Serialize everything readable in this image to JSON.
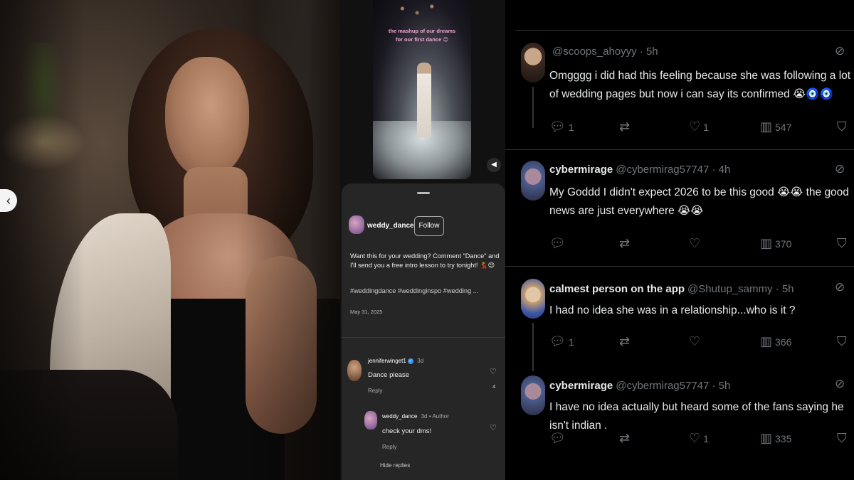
{
  "instagram": {
    "video_caption_line1": "the mashup of our dreams",
    "video_caption_line2": "for our first dance 😊",
    "username": "weddy_dance",
    "follow_label": "Follow",
    "caption": "Want this for your wedding? Comment \"Dance\" and I'll send you a free intro lesson to try tonight! 💃😍",
    "tags": "#weddingdance #weddinginspo #wedding ...",
    "date": "May 31, 2025",
    "comments": [
      {
        "user": "jenniferwinget1",
        "time": "3d",
        "text": "Dance please",
        "reply_label": "Reply",
        "likes": "4"
      },
      {
        "user": "weddy_dance",
        "meta": "3d • Author",
        "text": "check your dms!",
        "reply_label": "Reply"
      }
    ],
    "hide_replies_label": "Hide replies"
  },
  "x": {
    "tweets": [
      {
        "display_name": "",
        "handle": "@scoops_ahoyyy · 5h",
        "text": "Omgggg i did had this feeling because she was following a lot of wedding pages but now i can say its confirmed 😭🧿🧿",
        "replies": "1",
        "reposts": "",
        "likes": "1",
        "views": "547"
      },
      {
        "display_name": "cybermirage",
        "handle": "@cybermirag57747 · 4h",
        "text": "My Goddd I didn't expect 2026 to be this good 😭😭 the good news are just everywhere 😭😭",
        "replies": "",
        "reposts": "",
        "likes": "",
        "views": "370"
      },
      {
        "display_name": "calmest person on the app",
        "handle": "@Shutup_sammy · 5h",
        "text": "I had no idea she was in a relationship...who is it ?",
        "replies": "1",
        "reposts": "",
        "likes": "",
        "views": "366"
      },
      {
        "display_name": "cybermirage",
        "handle": "@cybermirag57747 · 5h",
        "text": "I have no idea actually but heard some of the fans saying he isn't indian .",
        "replies": "",
        "reposts": "",
        "likes": "1",
        "views": "335"
      }
    ]
  },
  "icons": {
    "reply": "reply-icon",
    "repost": "repost-icon",
    "like": "heart-icon",
    "views": "views-icon",
    "bookmark": "bookmark-icon",
    "grok": "grok-icon"
  },
  "colors": {
    "x_background": "#000000",
    "x_muted": "#71767b",
    "ig_sheet": "#262626",
    "ig_caption_pink": "#f3a6d9",
    "verified_blue": "#3897f0"
  }
}
